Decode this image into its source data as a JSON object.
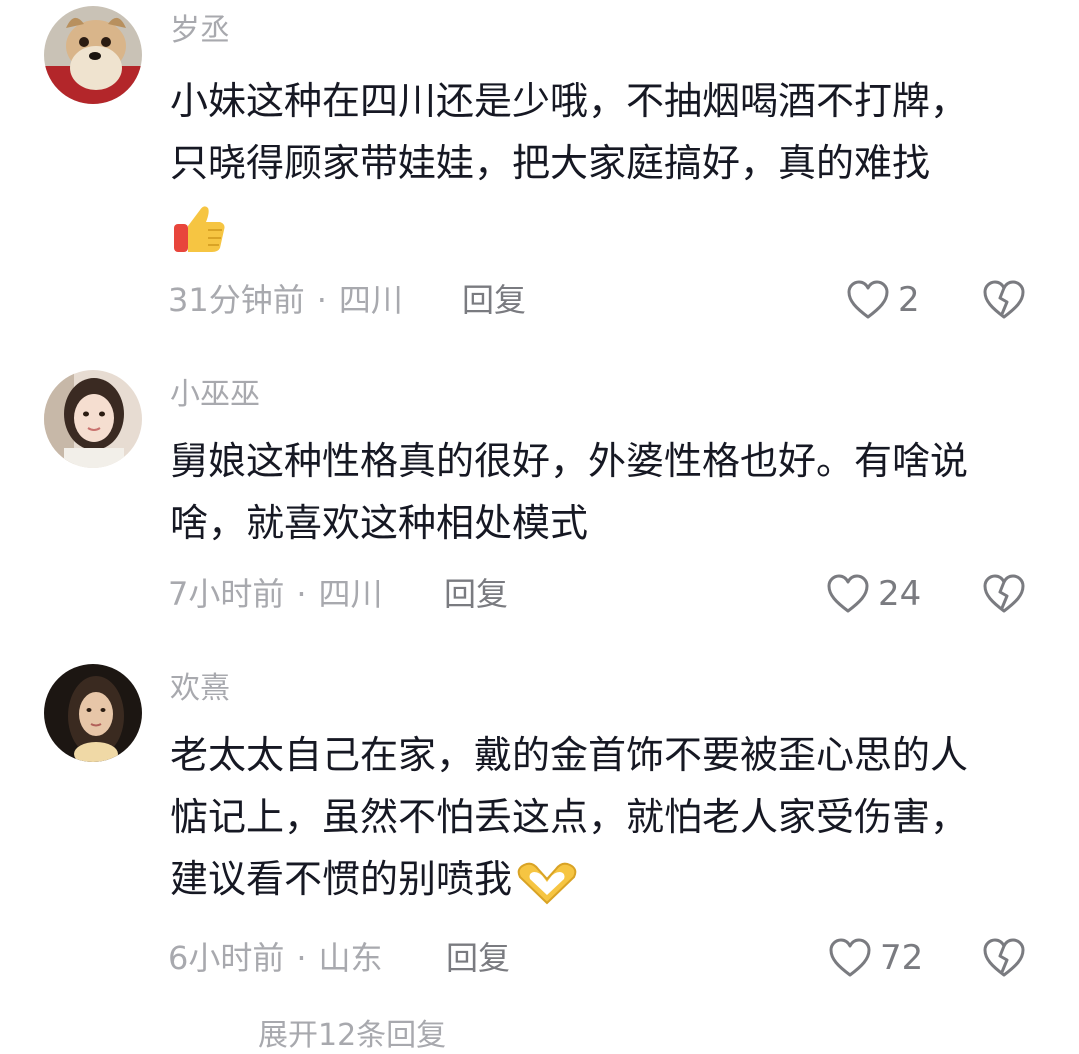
{
  "comments": [
    {
      "username": "岁丞",
      "lines": [
        "小妹这种在四川还是少哦，不抽烟喝酒不打牌，",
        "只晓得顾家带娃娃，把大家庭搞好，真的难找"
      ],
      "emoji": "thumbs-up-emoji",
      "time": "31分钟前",
      "location": "四川",
      "reply_label": "回复",
      "likes": "2"
    },
    {
      "username": "小巫巫",
      "lines": [
        "舅娘这种性格真的很好，外婆性格也好。有啥说",
        "啥，就喜欢这种相处模式"
      ],
      "time": "7小时前",
      "location": "四川",
      "reply_label": "回复",
      "likes": "24"
    },
    {
      "username": "欢熹",
      "lines": [
        "老太太自己在家，戴的金首饰不要被歪心思的人",
        "惦记上，虽然不怕丢这点，就怕老人家受伤害，",
        "建议看不惯的别喷我"
      ],
      "emoji": "heart-hands-emoji",
      "time": "6小时前",
      "location": "山东",
      "reply_label": "回复",
      "likes": "72"
    }
  ],
  "separator": "·",
  "more_replies": "展开12条回复",
  "colors": {
    "text": "#161823",
    "secondary": "#a8a9ae",
    "icon": "#7a7b80"
  }
}
